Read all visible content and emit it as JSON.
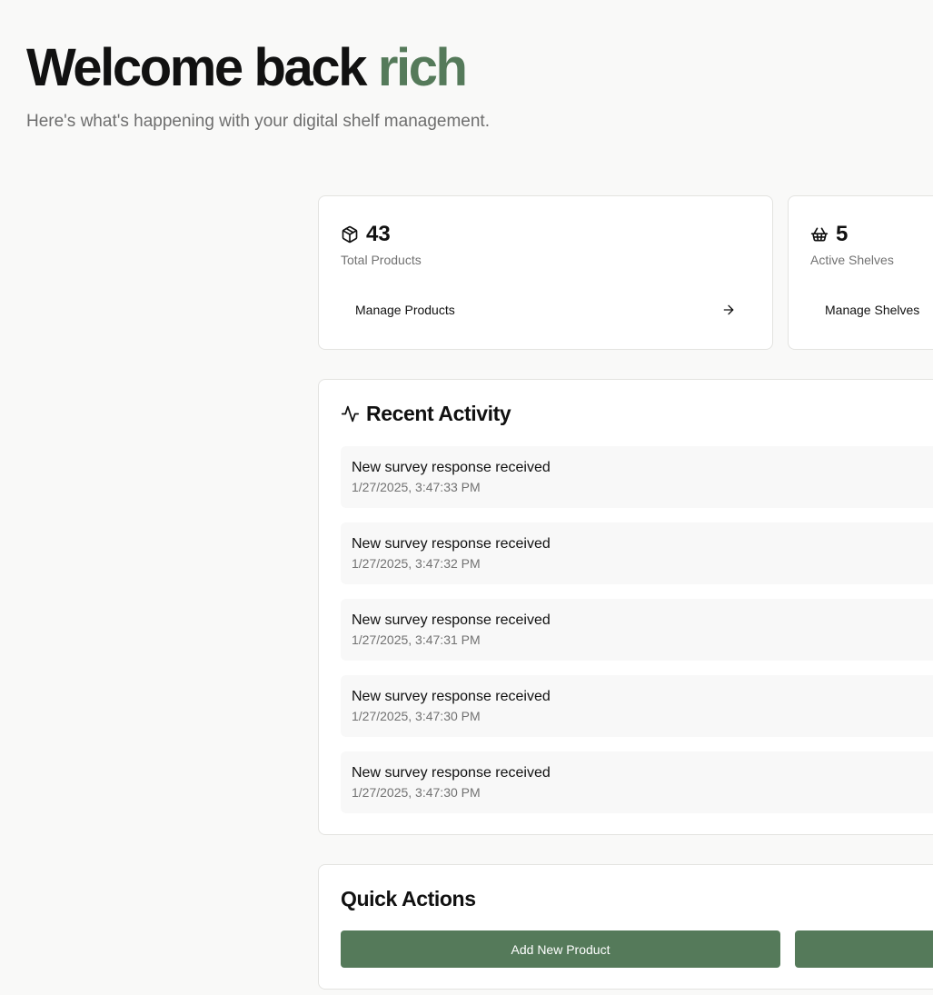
{
  "header": {
    "greeting": "Welcome back",
    "username": "rich",
    "subtitle": "Here's what's happening with your digital shelf management."
  },
  "stats": [
    {
      "icon": "package-icon",
      "value": "43",
      "label": "Total Products",
      "link_label": "Manage Products"
    },
    {
      "icon": "basket-icon",
      "value": "5",
      "label": "Active Shelves",
      "link_label": "Manage Shelves"
    }
  ],
  "activity": {
    "title": "Recent Activity",
    "icon": "activity-icon",
    "items": [
      {
        "message": "New survey response received",
        "time": "1/27/2025, 3:47:33 PM"
      },
      {
        "message": "New survey response received",
        "time": "1/27/2025, 3:47:32 PM"
      },
      {
        "message": "New survey response received",
        "time": "1/27/2025, 3:47:31 PM"
      },
      {
        "message": "New survey response received",
        "time": "1/27/2025, 3:47:30 PM"
      },
      {
        "message": "New survey response received",
        "time": "1/27/2025, 3:47:30 PM"
      }
    ]
  },
  "quick_actions": {
    "title": "Quick Actions",
    "buttons": [
      {
        "label": "Add New Product"
      },
      {
        "label": ""
      }
    ]
  },
  "colors": {
    "accent": "#557a5a",
    "background": "#f9f9f8",
    "card_border": "#e3e3e0",
    "muted_text": "#727272"
  }
}
